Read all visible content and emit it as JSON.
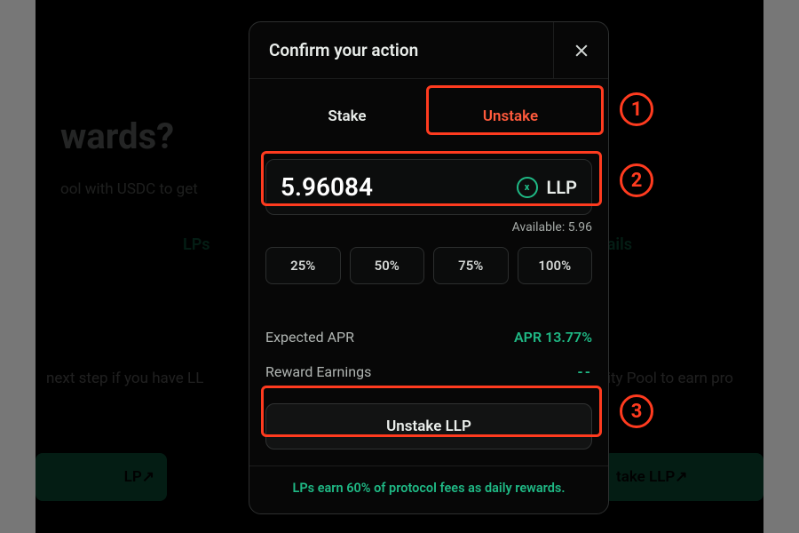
{
  "bg": {
    "heading_fragment": "wards?",
    "sub_fragment": "ool with USDC to get",
    "lps_fragment": "LPs",
    "ails_fragment": "ails",
    "maybe_fragment_left": "next step if you have LL",
    "maybe_fragment_right": "Liquidity Pool to earn pro",
    "pill_left": "LP↗",
    "pill_right": "take LLP↗"
  },
  "modal": {
    "title": "Confirm your action",
    "tabs": {
      "stake": "Stake",
      "unstake": "Unstake",
      "active": "unstake"
    },
    "amount": "5.96084",
    "token_symbol": "LLP",
    "token_icon_glyph": "x",
    "available_label": "Available:",
    "available_value": "5.96",
    "pct": [
      "25%",
      "50%",
      "75%",
      "100%"
    ],
    "rows": {
      "apr_label": "Expected APR",
      "apr_value": "APR 13.77%",
      "reward_label": "Reward Earnings",
      "reward_value": "--"
    },
    "cta": "Unstake LLP",
    "note": "LPs earn 60% of protocol fees as daily rewards."
  },
  "callouts": {
    "one": "1",
    "two": "2",
    "three": "3"
  }
}
